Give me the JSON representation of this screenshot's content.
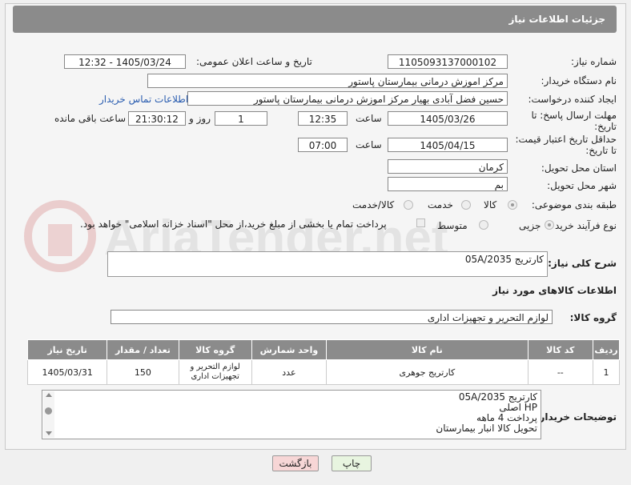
{
  "header": {
    "title": "جزئیات اطلاعات نیاز"
  },
  "fields": {
    "need_number_label": "شماره نیاز:",
    "need_number": "1105093137000102",
    "announce_label": "تاریخ و ساعت اعلان عمومی:",
    "announce_value": "1405/03/24 - 12:32",
    "buyer_org_label": "نام دستگاه خریدار:",
    "buyer_org": "مرکز اموزش درمانی بیمارستان پاستور",
    "creator_label": "ایجاد کننده درخواست:",
    "creator": "حسین فضل آبادی بهیار مرکز اموزش درمانی بیمارستان پاستور",
    "contact_link": "اطلاعات تماس خریدار",
    "reply_deadline_label": "مهلت ارسال پاسخ: تا تاریخ:",
    "reply_date": "1405/03/26",
    "time_label": "ساعت",
    "reply_time": "12:35",
    "days": "1",
    "days_label": "روز و",
    "remaining": "21:30:12",
    "remaining_label": "ساعت باقی مانده",
    "price_deadline_label": "حداقل تاریخ اعتبار قیمت: تا تاریخ:",
    "price_date": "1405/04/15",
    "price_time": "07:00",
    "province_label": "استان محل تحویل:",
    "province": "کرمان",
    "city_label": "شهر محل تحویل:",
    "city": "بم",
    "category_label": "طبقه بندی موضوعی:",
    "category_options": [
      "کالا",
      "خدمت",
      "کالا/خدمت"
    ],
    "process_label": "نوع فرآیند خرید :",
    "process_options": [
      "جزیی",
      "متوسط"
    ],
    "payment_note": "پرداخت تمام یا بخشی از مبلغ خرید،از محل \"اسناد خزانه اسلامی\" خواهد بود."
  },
  "summary": {
    "label": "شرح کلی نیاز:",
    "value": "کارتریج 05A/2035"
  },
  "goods": {
    "section_title": "اطلاعات کالاهای مورد نیاز",
    "group_label": "گروه کالا:",
    "group_value": "لوازم التحریر و تجهیزات اداری",
    "columns": [
      "ردیف",
      "کد کالا",
      "نام کالا",
      "واحد شمارش",
      "گروه کالا",
      "تعداد / مقدار",
      "تاریخ نیاز"
    ],
    "rows": [
      {
        "row": "1",
        "code": "--",
        "name": "کارتریج جوهری",
        "unit": "عدد",
        "group": "لوازم التحریر و تجهیزات اداری",
        "qty": "150",
        "date": "1405/03/31"
      }
    ]
  },
  "buyer_notes": {
    "label": "توضیحات خریدار:",
    "lines": [
      "کارتریج 05A/2035",
      "HP اصلی",
      "پرداخت 4 ماهه",
      "تحویل کالا انبار بیمارستان"
    ]
  },
  "buttons": {
    "print": "چاپ",
    "back": "بازگشت"
  },
  "watermark": "AriaTender.net",
  "colors": {
    "header_bg": "#8b8b8b",
    "link": "#2a5db0",
    "back_btn": "#f7d6d6",
    "print_btn": "#e8f5e0"
  }
}
